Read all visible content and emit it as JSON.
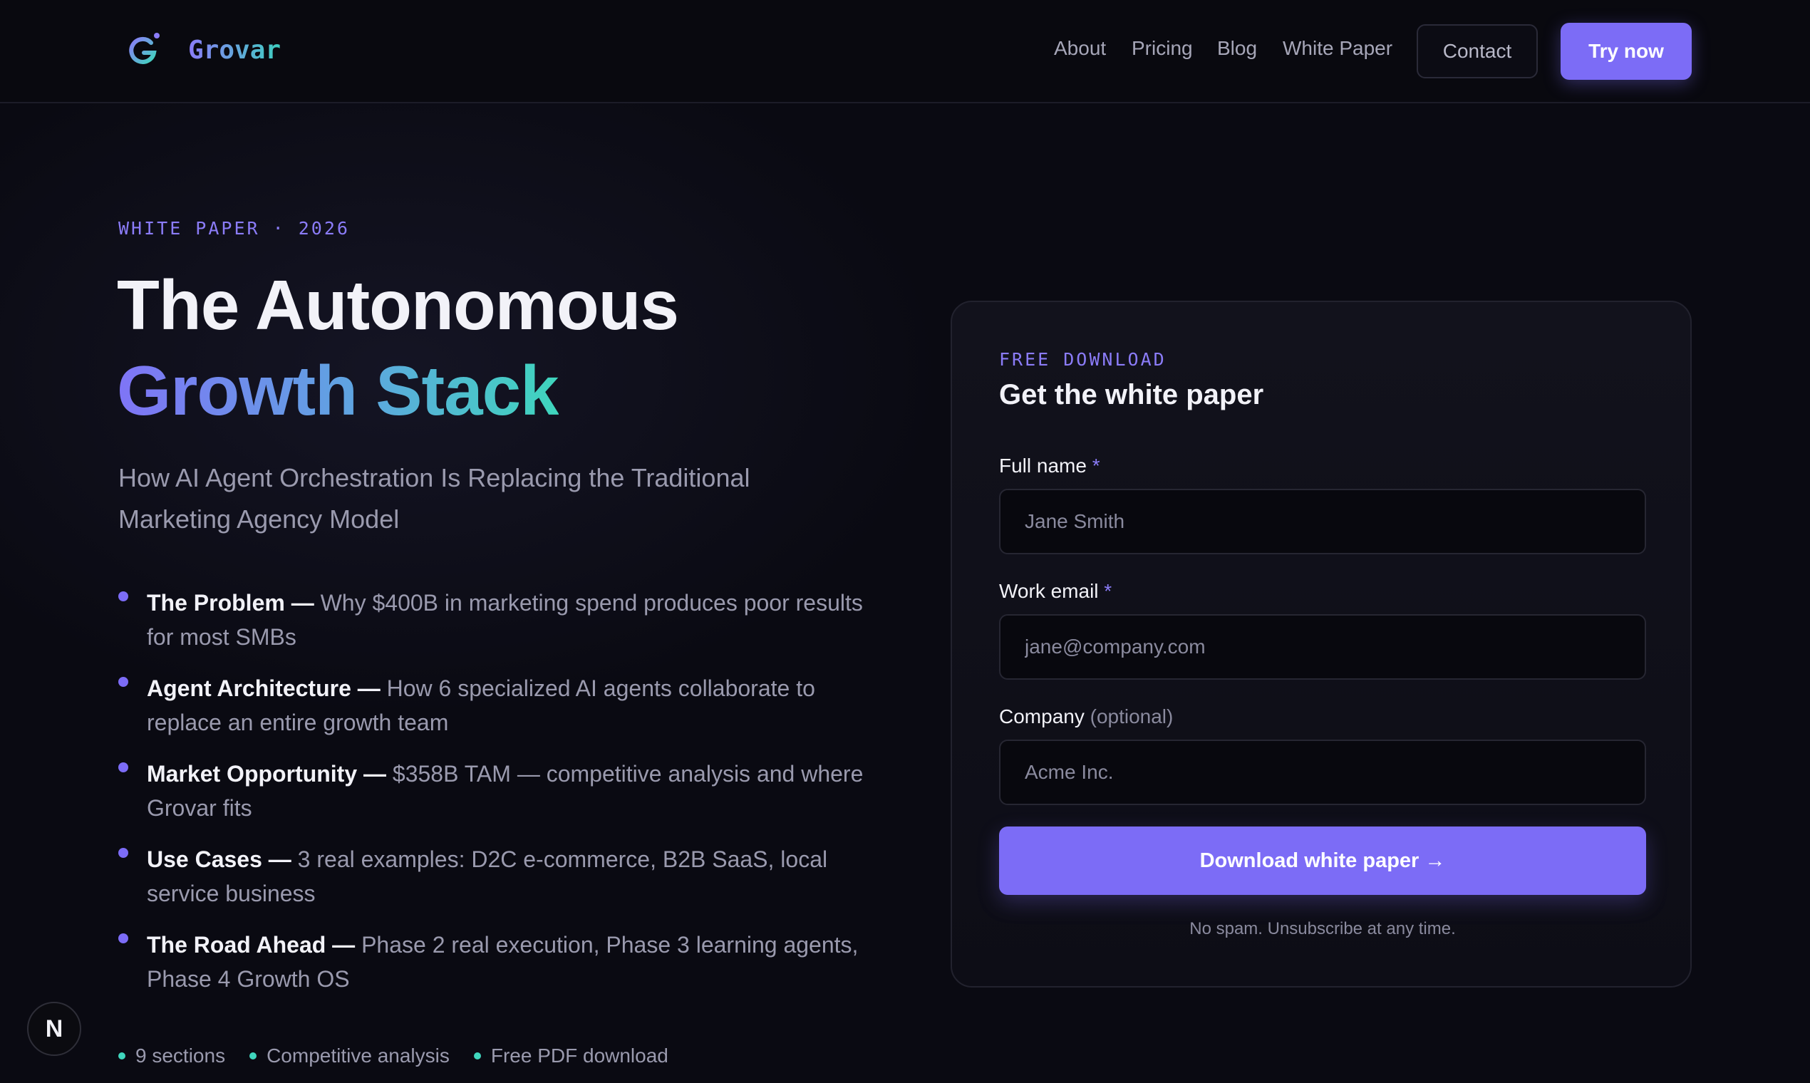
{
  "colors": {
    "accent": "#7c6cf6",
    "accent_teal": "#3fd6bd",
    "background": "#0a0a12"
  },
  "brand": {
    "name": "Grovar",
    "logo_icon": "grovar-g-logo-icon"
  },
  "nav": {
    "links": [
      "About",
      "Pricing",
      "Blog",
      "White Paper"
    ],
    "contact_label": "Contact",
    "cta_label": "Try now"
  },
  "hero": {
    "eyebrow": "WHITE PAPER · 2026",
    "title_line1": "The Autonomous",
    "title_line2": "Growth Stack",
    "subtitle": "How AI Agent Orchestration Is Replacing the Traditional Marketing Agency Model",
    "bullets": [
      {
        "title": "The Problem —",
        "text": " Why $400B in marketing spend produces poor results for most SMBs"
      },
      {
        "title": "Agent Architecture —",
        "text": " How 6 specialized AI agents collaborate to replace an entire growth team"
      },
      {
        "title": "Market Opportunity —",
        "text": " $358B TAM — competitive analysis and where Grovar fits"
      },
      {
        "title": "Use Cases —",
        "text": " 3 real examples: D2C e-commerce, B2B SaaS, local service business"
      },
      {
        "title": "The Road Ahead —",
        "text": " Phase 2 real execution, Phase 3 learning agents, Phase 4 Growth OS"
      }
    ],
    "meta": [
      "9 sections",
      "Competitive analysis",
      "Free PDF download"
    ]
  },
  "form": {
    "eyebrow": "FREE DOWNLOAD",
    "title": "Get the white paper",
    "fields": {
      "name": {
        "label": "Full name",
        "required_mark": "*",
        "placeholder": "Jane Smith",
        "value": ""
      },
      "email": {
        "label": "Work email",
        "required_mark": "*",
        "placeholder": "jane@company.com",
        "value": ""
      },
      "company": {
        "label": "Company",
        "optional_mark": "(optional)",
        "placeholder": "Acme Inc.",
        "value": ""
      }
    },
    "submit_label": "Download white paper →",
    "disclaimer": "No spam. Unsubscribe at any time."
  },
  "badge": {
    "letter": "N"
  }
}
